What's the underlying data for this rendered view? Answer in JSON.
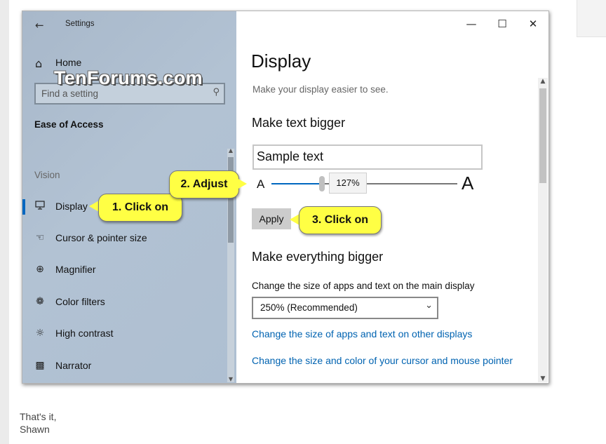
{
  "window": {
    "title": "Settings",
    "back_icon": "back-arrow-icon",
    "minimize": "—",
    "maximize": "☐",
    "close": "✕"
  },
  "sidebar": {
    "home_label": "Home",
    "watermark": "TenForums.com",
    "search_placeholder": "Find a setting",
    "section_title": "Ease of Access",
    "group_label": "Vision",
    "items": [
      {
        "label": "Display",
        "icon": "monitor-icon",
        "selected": true
      },
      {
        "label": "Cursor & pointer size",
        "icon": "cursor-icon",
        "selected": false
      },
      {
        "label": "Magnifier",
        "icon": "magnifier-icon",
        "selected": false
      },
      {
        "label": "Color filters",
        "icon": "color-filters-icon",
        "selected": false
      },
      {
        "label": "High contrast",
        "icon": "brightness-icon",
        "selected": false
      },
      {
        "label": "Narrator",
        "icon": "narrator-icon",
        "selected": false
      }
    ]
  },
  "main": {
    "title": "Display",
    "subtitle": "Make your display easier to see.",
    "text_bigger": {
      "heading": "Make text bigger",
      "sample_text": "Sample text",
      "small_a": "A",
      "large_a": "A",
      "slider_value": "127%",
      "slider_fraction": 0.27,
      "apply_label": "Apply"
    },
    "everything_bigger": {
      "heading": "Make everything bigger",
      "field_label": "Change the size of apps and text on the main display",
      "dropdown_value": "250% (Recommended)",
      "link_other_displays": "Change the size of apps and text on other displays",
      "link_cursor": "Change the size and color of your cursor and mouse pointer"
    }
  },
  "callouts": {
    "step1": "1. Click on",
    "step2": "2. Adjust",
    "step3": "3. Click on"
  },
  "footer": {
    "line1": "That's it,",
    "line2": "Shawn"
  },
  "colors": {
    "accent": "#0067c0",
    "link": "#0063b1",
    "callout": "#ffff44"
  }
}
